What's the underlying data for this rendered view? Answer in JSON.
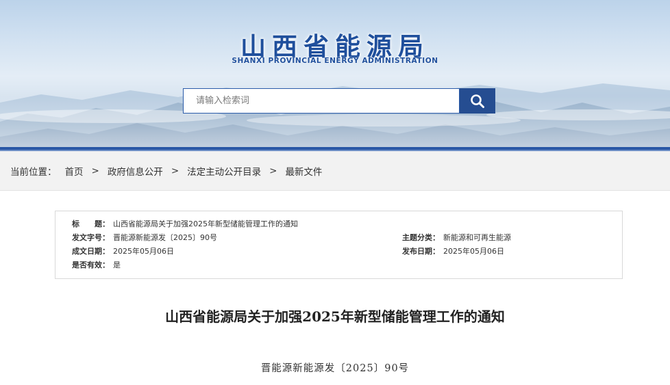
{
  "header": {
    "site_title": "山西省能源局",
    "site_subtitle": "SHANXI  PROVINCIAL  ENERGY  ADMINISTRATION",
    "search": {
      "placeholder": "请输入检索词",
      "button_icon": "search-icon"
    }
  },
  "breadcrumb": {
    "prefix": "当前位置：",
    "items": [
      "首页",
      "政府信息公开",
      "法定主动公开目录",
      "最新文件"
    ],
    "separator": ">"
  },
  "meta": {
    "title_label": "标　　题：",
    "title_value": "山西省能源局关于加强2025年新型储能管理工作的通知",
    "doc_no_label": "发文字号：",
    "doc_no_value": "晋能源新能源发〔2025〕90号",
    "topic_label": "主题分类：",
    "topic_value": "新能源和可再生能源",
    "written_label": "成文日期：",
    "written_value": "2025年05月06日",
    "published_label": "发布日期：",
    "published_value": "2025年05月06日",
    "valid_label": "是否有效：",
    "valid_value": "是"
  },
  "article": {
    "title": "山西省能源局关于加强2025年新型储能管理工作的通知",
    "doc_number": "晋能源新能源发〔2025〕90号"
  },
  "colors": {
    "brand_blue": "#254d91",
    "title_blue": "#1f4f9c",
    "breadcrumb_bg": "#f2f2f2"
  }
}
